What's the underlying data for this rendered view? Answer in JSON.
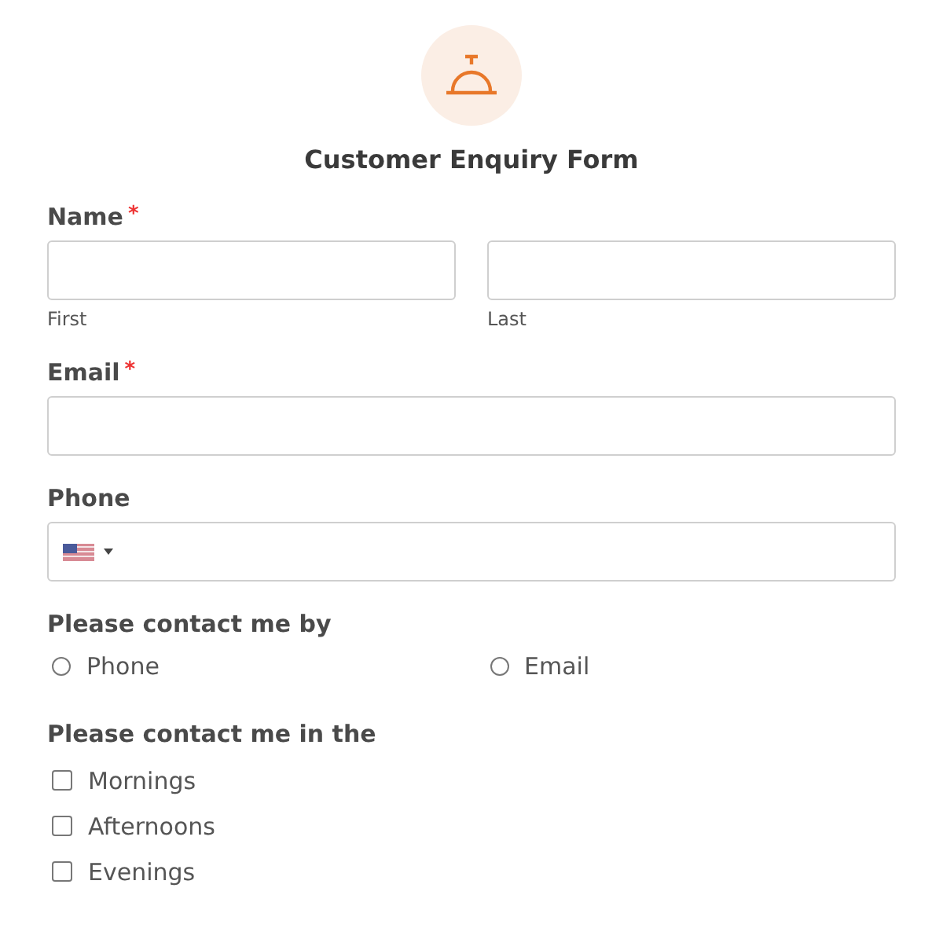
{
  "form": {
    "title": "Customer Enquiry Form"
  },
  "name": {
    "label": "Name",
    "required_mark": "*",
    "subfields": [
      {
        "sublabel": "First"
      },
      {
        "sublabel": "Last"
      }
    ]
  },
  "email": {
    "label": "Email",
    "required_mark": "*"
  },
  "phone": {
    "label": "Phone"
  },
  "contact_by": {
    "label": "Please contact me by",
    "options": [
      {
        "label": "Phone",
        "selected": false
      },
      {
        "label": "Email",
        "selected": false
      }
    ]
  },
  "contact_time": {
    "label": "Please contact me in the",
    "options": [
      {
        "label": "Mornings",
        "checked": false
      },
      {
        "label": "Afternoons",
        "checked": false
      },
      {
        "label": "Evenings",
        "checked": false
      }
    ]
  }
}
